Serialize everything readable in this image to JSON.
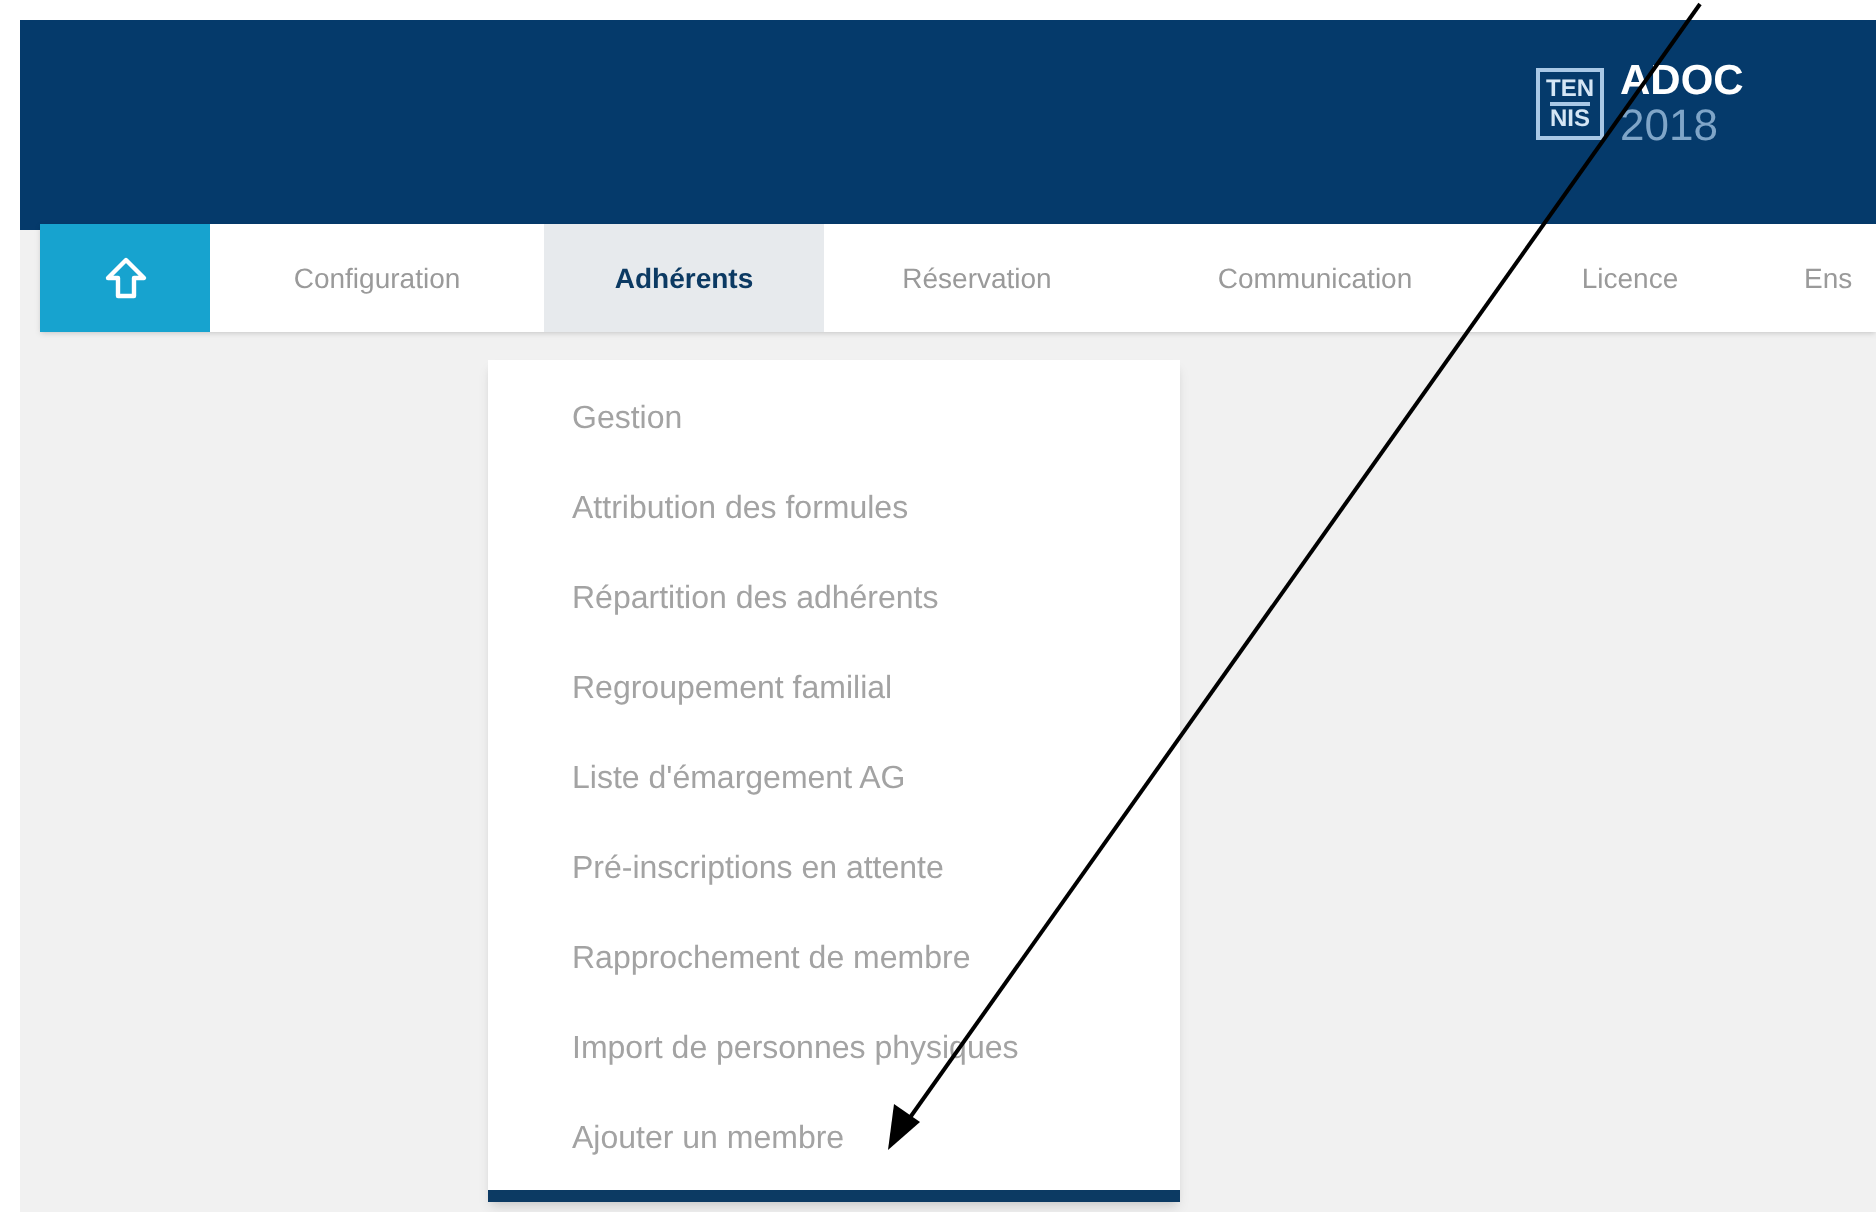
{
  "logo": {
    "badge_lines": [
      "TEN",
      "NIS"
    ],
    "name": "ADOC",
    "year": "2018"
  },
  "nav": {
    "tabs": [
      {
        "label": "Configuration",
        "selected": false
      },
      {
        "label": "Adhérents",
        "selected": true
      },
      {
        "label": "Réservation",
        "selected": false
      },
      {
        "label": "Communication",
        "selected": false
      },
      {
        "label": "Licence",
        "selected": false
      },
      {
        "label": "Ens",
        "selected": false
      }
    ]
  },
  "dropdown": {
    "items": [
      "Gestion",
      "Attribution des formules",
      "Répartition des adhérents",
      "Regroupement familial",
      "Liste d'émargement AG",
      "Pré-inscriptions en attente",
      "Rapprochement de membre",
      "Import de personnes physiques",
      "Ajouter un membre"
    ]
  },
  "annotation": {
    "kind": "arrow"
  }
}
